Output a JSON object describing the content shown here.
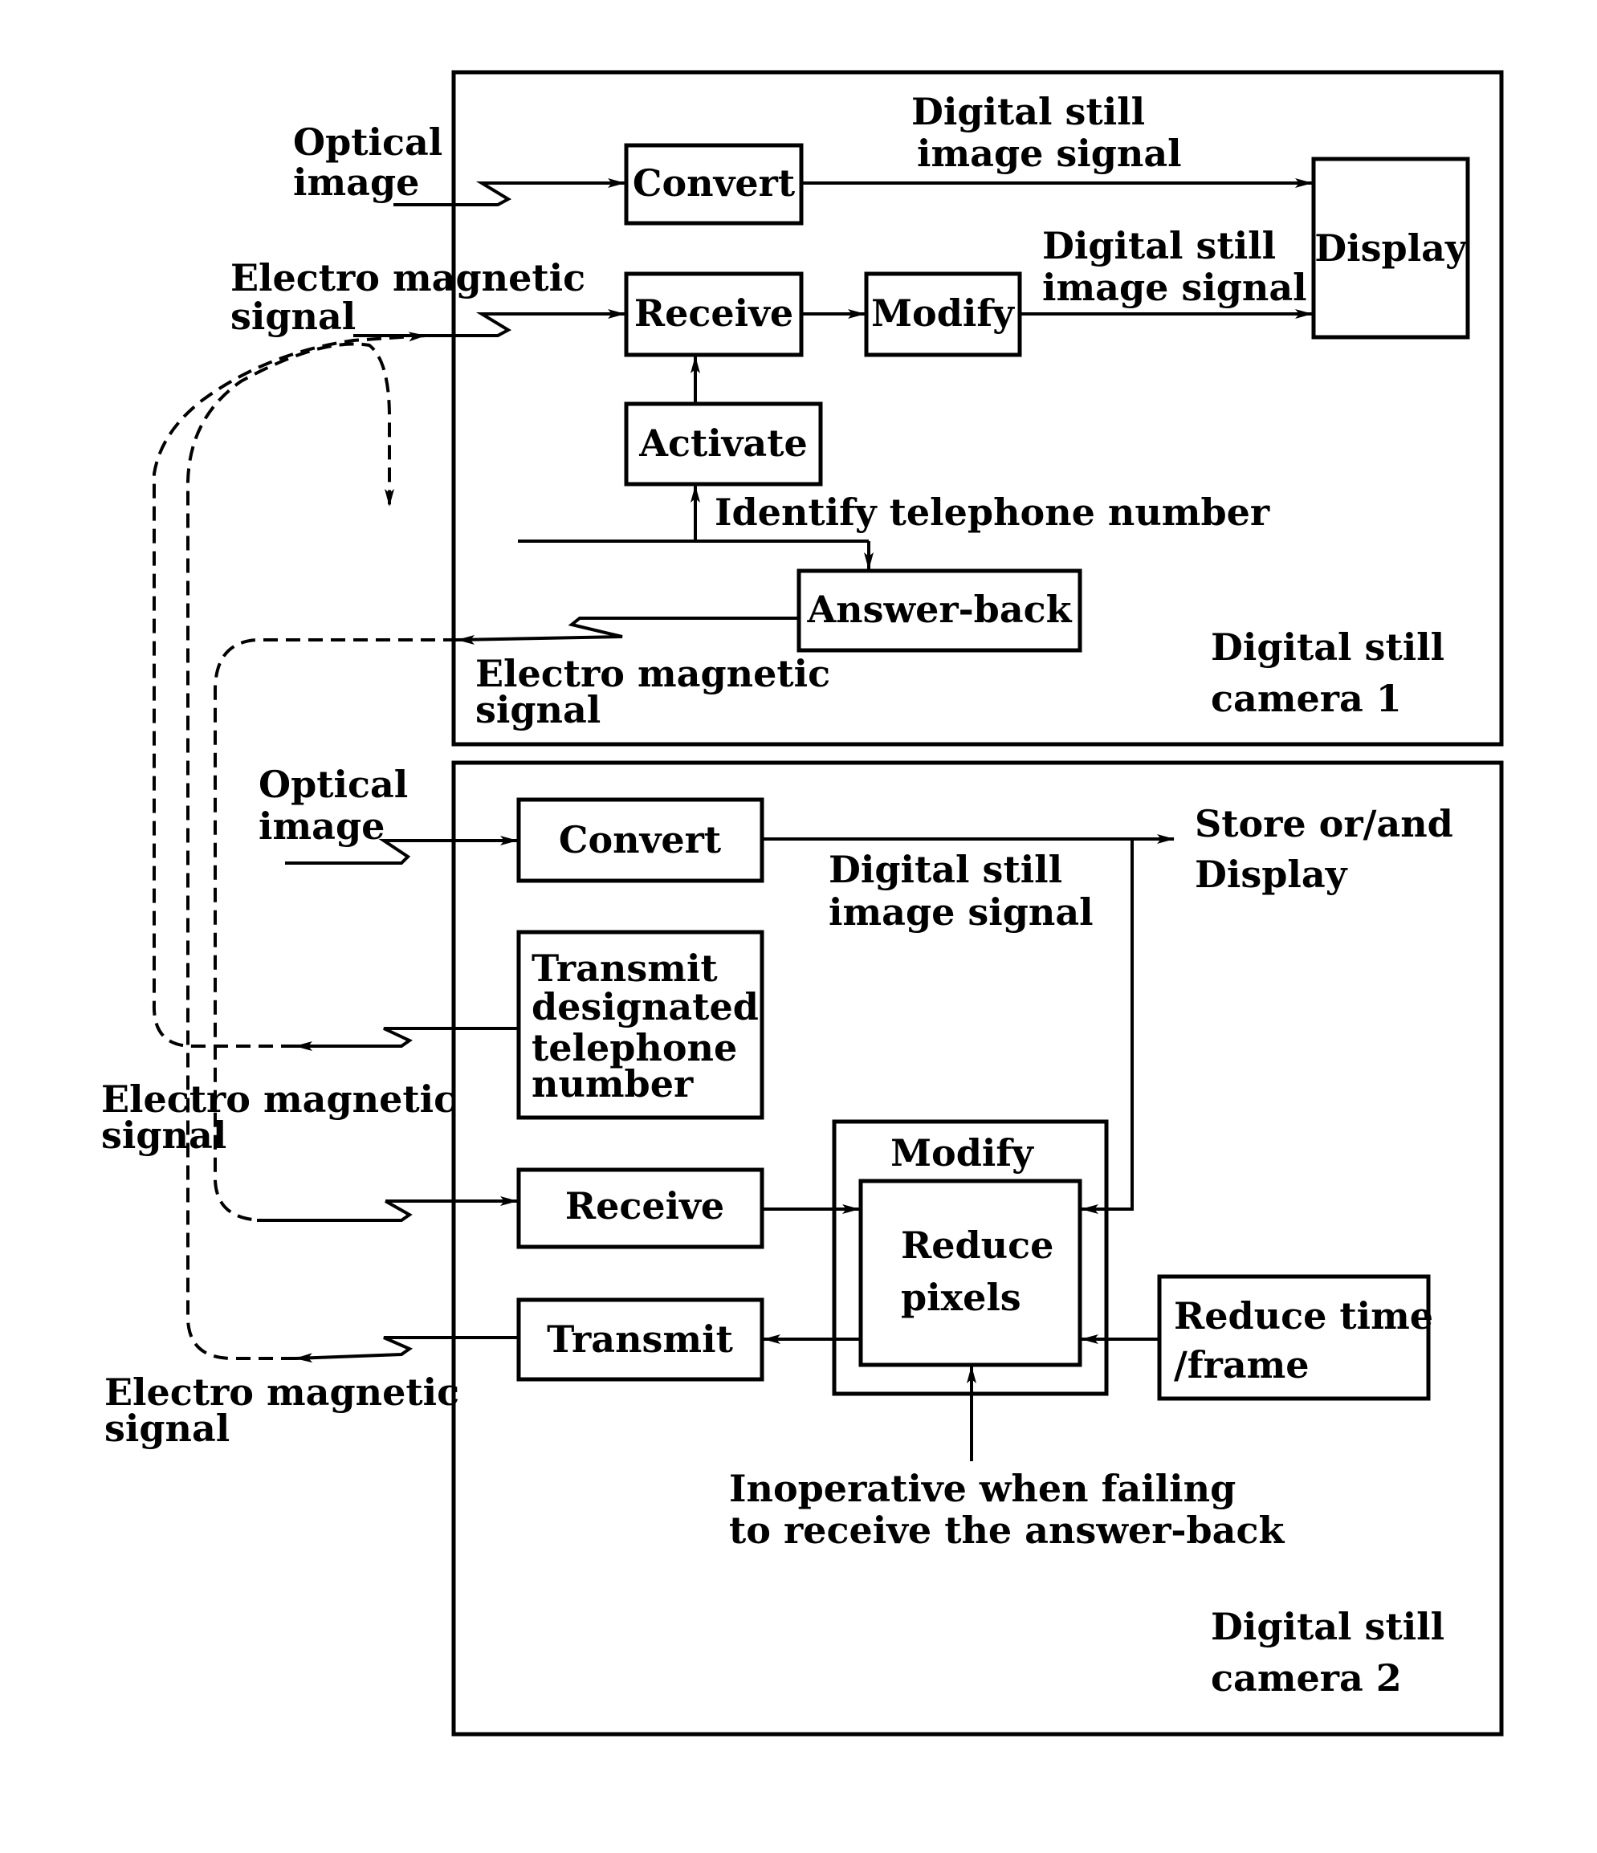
{
  "camera1": {
    "label_line1": "Digital still",
    "label_line2": "camera 1",
    "inputs": {
      "optical": [
        "Optical",
        "image"
      ],
      "em": [
        "Electro magnetic",
        "signal"
      ]
    },
    "blocks": {
      "convert": "Convert",
      "receive": "Receive",
      "modify": "Modify",
      "activate": "Activate",
      "answer_back": "Answer-back",
      "display": "Display"
    },
    "signal_label_1": [
      "Digital still",
      "image signal"
    ],
    "signal_label_2": [
      "Digital still",
      "image signal"
    ],
    "identify_label": "Identify telephone number",
    "em_out": [
      "Electro magnetic",
      "signal"
    ]
  },
  "camera2": {
    "label_line1": "Digital still",
    "label_line2": "camera 2",
    "inputs": {
      "optical": [
        "Optical",
        "image"
      ]
    },
    "blocks": {
      "convert": "Convert",
      "transmit_designated": [
        "Transmit",
        "designated",
        "telephone",
        "number"
      ],
      "receive": "Receive",
      "transmit": "Transmit",
      "modify_group": "Modify",
      "reduce_pixels": [
        "Reduce",
        "pixels"
      ],
      "reduce_time": [
        "Reduce time",
        "/frame"
      ]
    },
    "signal_label": [
      "Digital still",
      "image signal"
    ],
    "store_display": [
      "Store or/and",
      "Display"
    ],
    "em_out_1": [
      "Electro magnetic",
      "signal"
    ],
    "em_out_2": [
      "Electro magnetic",
      "signal"
    ],
    "inoperative_note": [
      "Inoperative when failing",
      "to receive the answer-back"
    ]
  }
}
